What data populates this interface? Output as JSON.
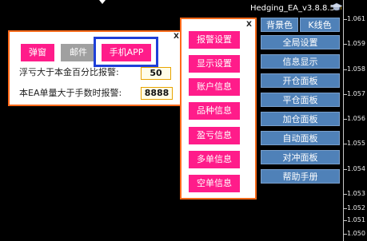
{
  "chart": {
    "ea_title": "Hedging_EA_v3.8.8.5",
    "price_labels": [
      "1.061",
      "1.059",
      "1.058",
      "1.057",
      "1.056",
      "1.055",
      "1.054",
      "1.053",
      "1.052",
      "1.051",
      "1.050"
    ]
  },
  "alert_panel": {
    "close_label": "X",
    "tabs": [
      "弹窗",
      "邮件",
      "手机APP"
    ],
    "rows": [
      {
        "label": "浮亏大于本金百分比报警:",
        "value": "50"
      },
      {
        "label": "本EA单量大于手数时报警:",
        "value": "8888"
      }
    ]
  },
  "menu_panel": {
    "close_label": "X",
    "items": [
      "报警设置",
      "显示设置",
      "账户信息",
      "品种信息",
      "盈亏信息",
      "多单信息",
      "空单信息"
    ]
  },
  "side_panel": {
    "top_buttons": [
      "背景色",
      "K线色"
    ],
    "buttons": [
      "全局设置",
      "信息显示",
      "开仓面板",
      "平仓面板",
      "加仓面板",
      "自动面板",
      "对冲面板",
      "帮助手册"
    ]
  },
  "colors": {
    "menu_accent": "#ff1c8a",
    "panel_border": "#ff6a1a",
    "side_button": "#4f81b8",
    "selection_frame": "#1e3fd8"
  },
  "icons": [
    "graduation-cap-icon",
    "marker-icon"
  ]
}
